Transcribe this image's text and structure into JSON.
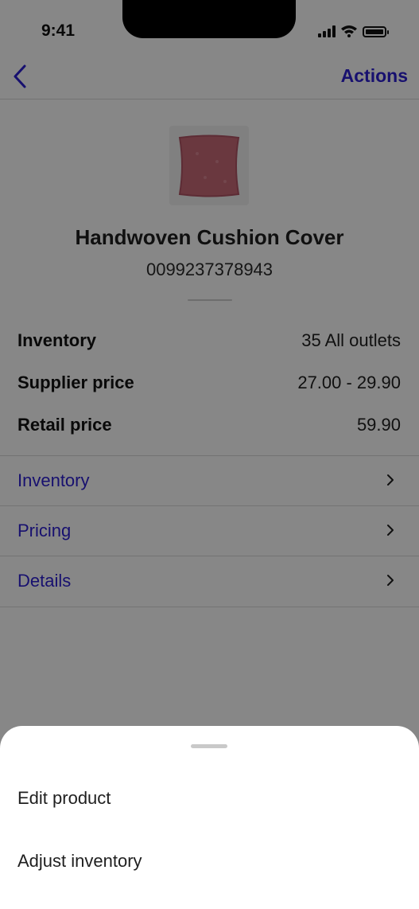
{
  "status_bar": {
    "time": "9:41"
  },
  "nav": {
    "back_icon": "chevron-left-icon",
    "actions_label": "Actions"
  },
  "product": {
    "title": "Handwoven Cushion Cover",
    "sku": "0099237378943",
    "image_icon": "cushion-image"
  },
  "summary": [
    {
      "label": "Inventory",
      "value": "35 All outlets"
    },
    {
      "label": "Supplier price",
      "value": "27.00 - 29.90"
    },
    {
      "label": "Retail price",
      "value": "59.90"
    }
  ],
  "links": [
    {
      "label": "Inventory",
      "icon": "chevron-right-icon"
    },
    {
      "label": "Pricing",
      "icon": "chevron-right-icon"
    },
    {
      "label": "Details",
      "icon": "chevron-right-icon"
    }
  ],
  "sheet": {
    "items": [
      {
        "label": "Edit product"
      },
      {
        "label": "Adjust inventory"
      }
    ]
  },
  "colors": {
    "accent": "#2d1fd1",
    "scrim": "rgba(0,0,0,0.47)",
    "cushion": "#c86a78"
  }
}
